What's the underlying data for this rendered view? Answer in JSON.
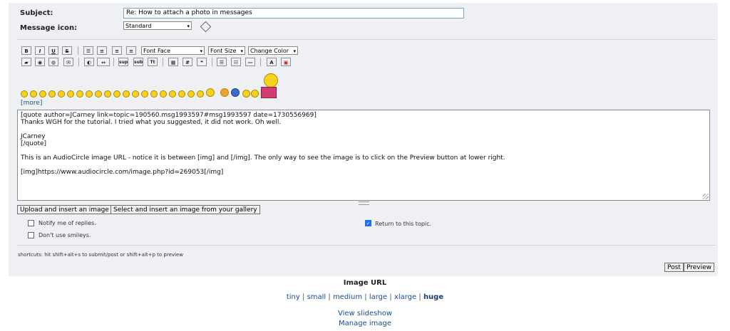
{
  "form": {
    "subject_label": "Subject:",
    "subject_value": "Re: How to attach a photo in messages",
    "icon_label": "Message icon:",
    "icon_value": "Standard"
  },
  "toolbar": {
    "row1_buttons": [
      "B",
      "I",
      "U",
      "S"
    ],
    "font_face": "Font Face",
    "font_size": "Font Size",
    "change_color": "Change Color",
    "row2_labels": [
      "sup",
      "sub",
      "Tt",
      "#"
    ]
  },
  "more_link": "[more]",
  "message_lines": [
    "[quote author=JCarney link=topic=190560.msg1993597#msg1993597 date=1730556969]",
    "Thanks WGH for the tutorial. I tried what you suggested, it did not work. Oh well.",
    "",
    "JCarney",
    "[/quote]",
    "",
    "This is an AudioCircle image URL - notice it is between [img] and [/img]. The only way to see the image is to click on the Preview button at lower right.",
    "",
    "[img]https://www.audiocircle.com/image.php?id=269053[/img]"
  ],
  "upload_buttons": {
    "upload": "Upload and insert an image",
    "gallery": "Select and insert an image from your gallery"
  },
  "options": {
    "notify": "Notify me of replies.",
    "no_smileys": "Don't use smileys.",
    "return_topic": "Return to this topic."
  },
  "shortcuts": "shortcuts: hit shift+alt+s to submit/post or shift+alt+p to preview",
  "actions": {
    "post": "Post",
    "preview": "Preview"
  },
  "image_url": {
    "title": "Image URL",
    "sizes": [
      "tiny",
      "small",
      "medium",
      "large",
      "xlarge",
      "huge"
    ],
    "current": "huge",
    "view_slideshow": "View slideshow",
    "manage_image": "Manage image"
  },
  "colors": {
    "panel": "#eef0f4",
    "link": "#1a4c8c",
    "checkbox_on": "#1a73e8"
  }
}
